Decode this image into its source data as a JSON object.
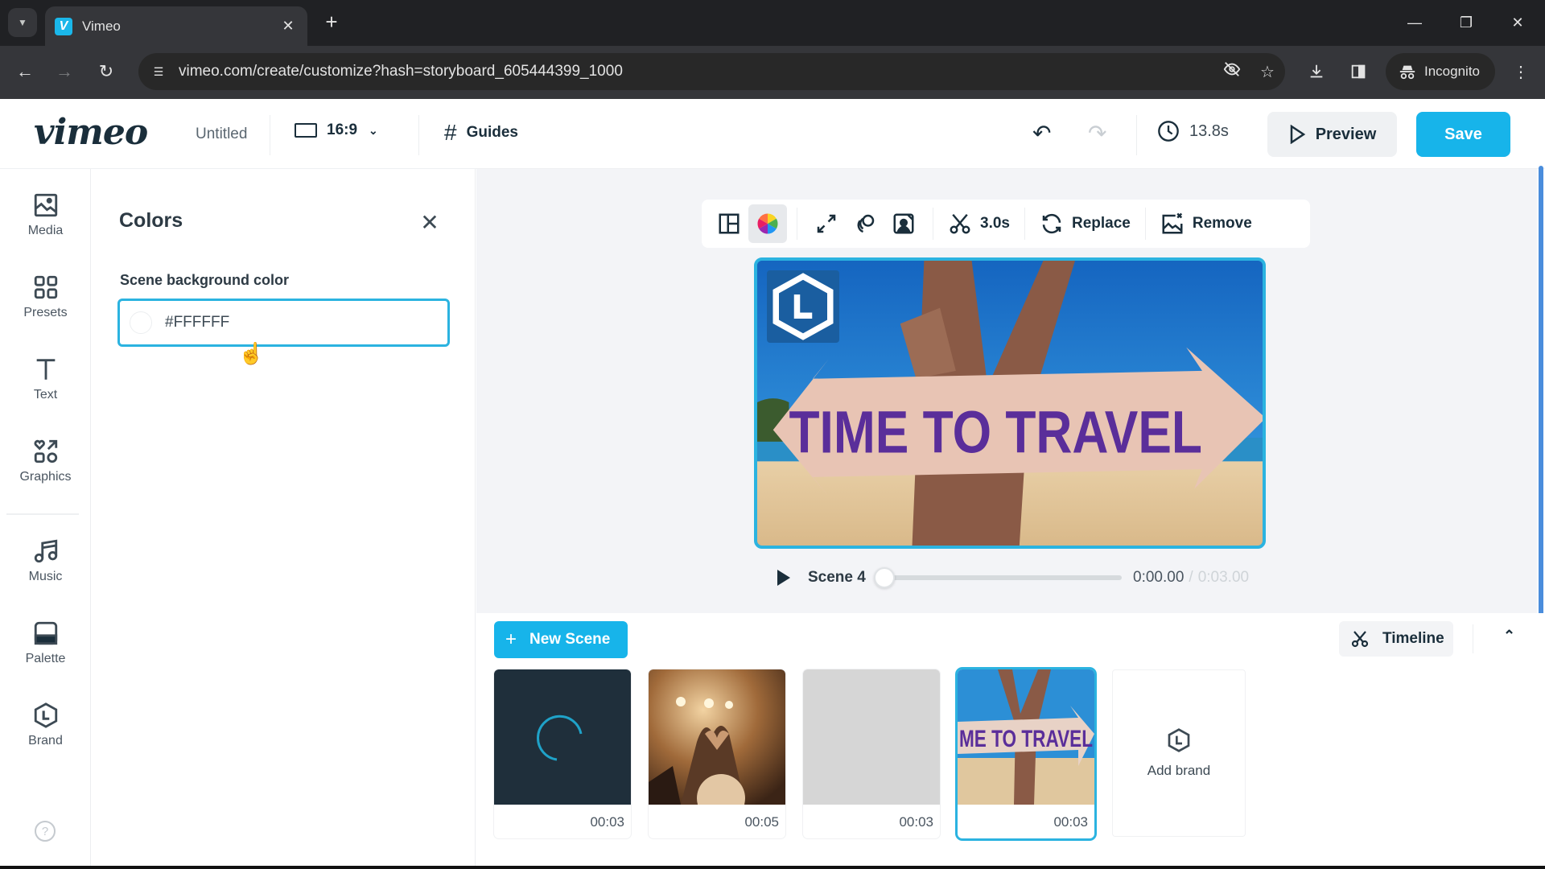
{
  "browser": {
    "tab_title": "Vimeo",
    "tab_favicon_letter": "V",
    "url": "vimeo.com/create/customize?hash=storyboard_605444399_1000",
    "incognito_label": "Incognito"
  },
  "header": {
    "logo": "vimeo",
    "doc_title": "Untitled",
    "aspect_ratio": "16:9",
    "guides_label": "Guides",
    "duration": "13.8s",
    "preview_label": "Preview",
    "save_label": "Save",
    "accent_color": "#17b4ea"
  },
  "rail": {
    "items": [
      {
        "label": "Media",
        "icon": "image-icon"
      },
      {
        "label": "Presets",
        "icon": "grid-icon"
      },
      {
        "label": "Text",
        "icon": "text-icon"
      },
      {
        "label": "Graphics",
        "icon": "graphics-icon"
      },
      {
        "label": "Music",
        "icon": "music-icon"
      },
      {
        "label": "Palette",
        "icon": "palette-icon"
      },
      {
        "label": "Brand",
        "icon": "brand-icon"
      }
    ],
    "help_glyph": "?"
  },
  "panel": {
    "title": "Colors",
    "field_label": "Scene background color",
    "field_value": "#FFFFFF"
  },
  "scene_toolbar": {
    "duration_label": "3.0s",
    "replace_label": "Replace",
    "remove_label": "Remove"
  },
  "preview": {
    "sign_text": "TIME TO TRAVEL"
  },
  "player": {
    "scene_label": "Scene 4",
    "current_time": "0:00.00",
    "separator": "/",
    "total_time": "0:03.00",
    "progress_fraction": 0
  },
  "storyboard": {
    "new_scene_label": "New Scene",
    "timeline_label": "Timeline",
    "scenes": [
      {
        "duration": "00:03",
        "kind": "loading",
        "selected": false
      },
      {
        "duration": "00:05",
        "kind": "concert",
        "selected": false
      },
      {
        "duration": "00:03",
        "kind": "blank",
        "selected": false
      },
      {
        "duration": "00:03",
        "kind": "travel",
        "selected": true,
        "thumb_text": "ME TO TRAVEL"
      }
    ],
    "add_brand_label": "Add brand"
  }
}
